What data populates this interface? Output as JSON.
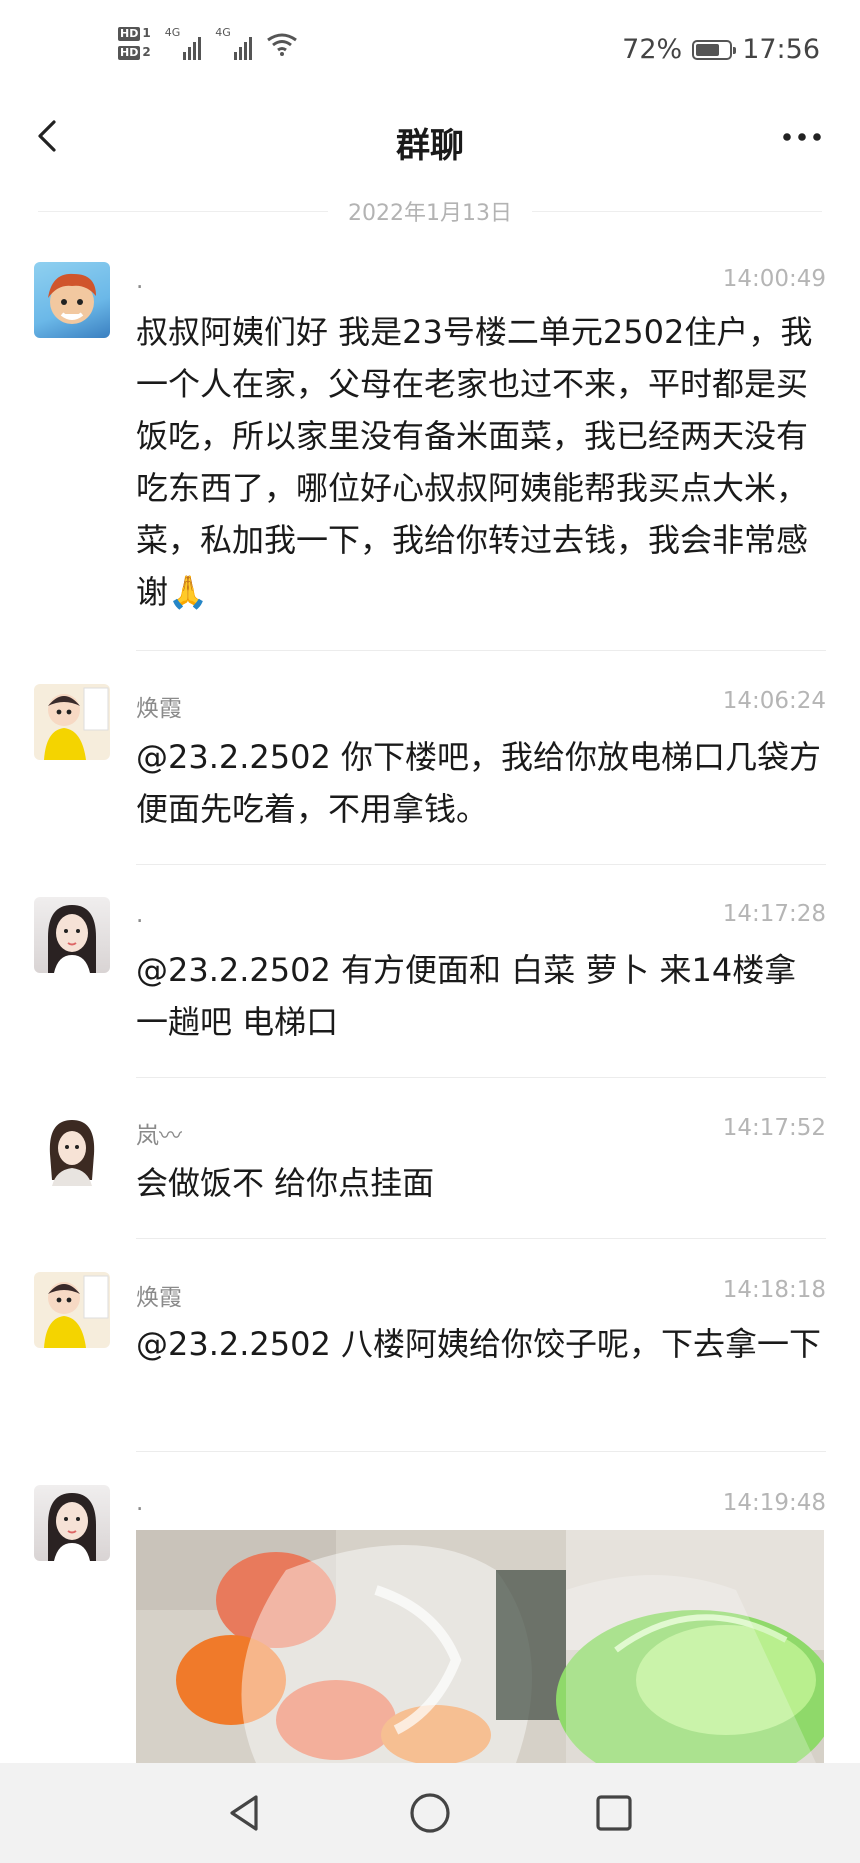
{
  "status_bar": {
    "hd1": "HD",
    "hd1_num": "1",
    "hd2": "HD",
    "hd2_num": "2",
    "net1": "4G",
    "net2": "4G",
    "battery_percent": "72%",
    "battery_level": 0.72,
    "time": "17:56"
  },
  "header": {
    "title": "群聊",
    "back_icon": "chevron-left-icon",
    "more_icon": "more-horizontal-icon"
  },
  "date_separator": "2022年1月13日",
  "messages": [
    {
      "sender": ".",
      "time": "14:00:49",
      "text": "叔叔阿姨们好 我是23号楼二单元2502住户，我一个人在家，父母在老家也过不来，平时都是买饭吃，所以家里没有备米面菜，我已经两天没有吃东西了，哪位好心叔叔阿姨能帮我买点大米，菜，私加我一下，我给你转过去钱，我会非常感谢🙏"
    },
    {
      "sender": "焕霞",
      "time": "14:06:24",
      "text": "@23.2.2502 你下楼吧，我给你放电梯口几袋方便面先吃着，不用拿钱。"
    },
    {
      "sender": ".",
      "time": "14:17:28",
      "text": "@23.2.2502  有方便面和 白菜 萝卜 来14楼拿一趟吧 电梯口"
    },
    {
      "sender": "岚〰",
      "time": "14:17:52",
      "text": "会做饭不 给你点挂面"
    },
    {
      "sender": "焕霞",
      "time": "14:18:18",
      "text": "@23.2.2502 八楼阿姨给你饺子呢，下去拿一下"
    },
    {
      "sender": ".",
      "time": "14:19:48",
      "image": "photo-of-food-bags"
    }
  ],
  "nav": {
    "back": "triangle-back-icon",
    "home": "circle-home-icon",
    "recents": "square-recents-icon"
  },
  "colors": {
    "background": "#ffffff",
    "nav_bar": "#f2f2f2",
    "meta_text": "#b5b5b5"
  }
}
